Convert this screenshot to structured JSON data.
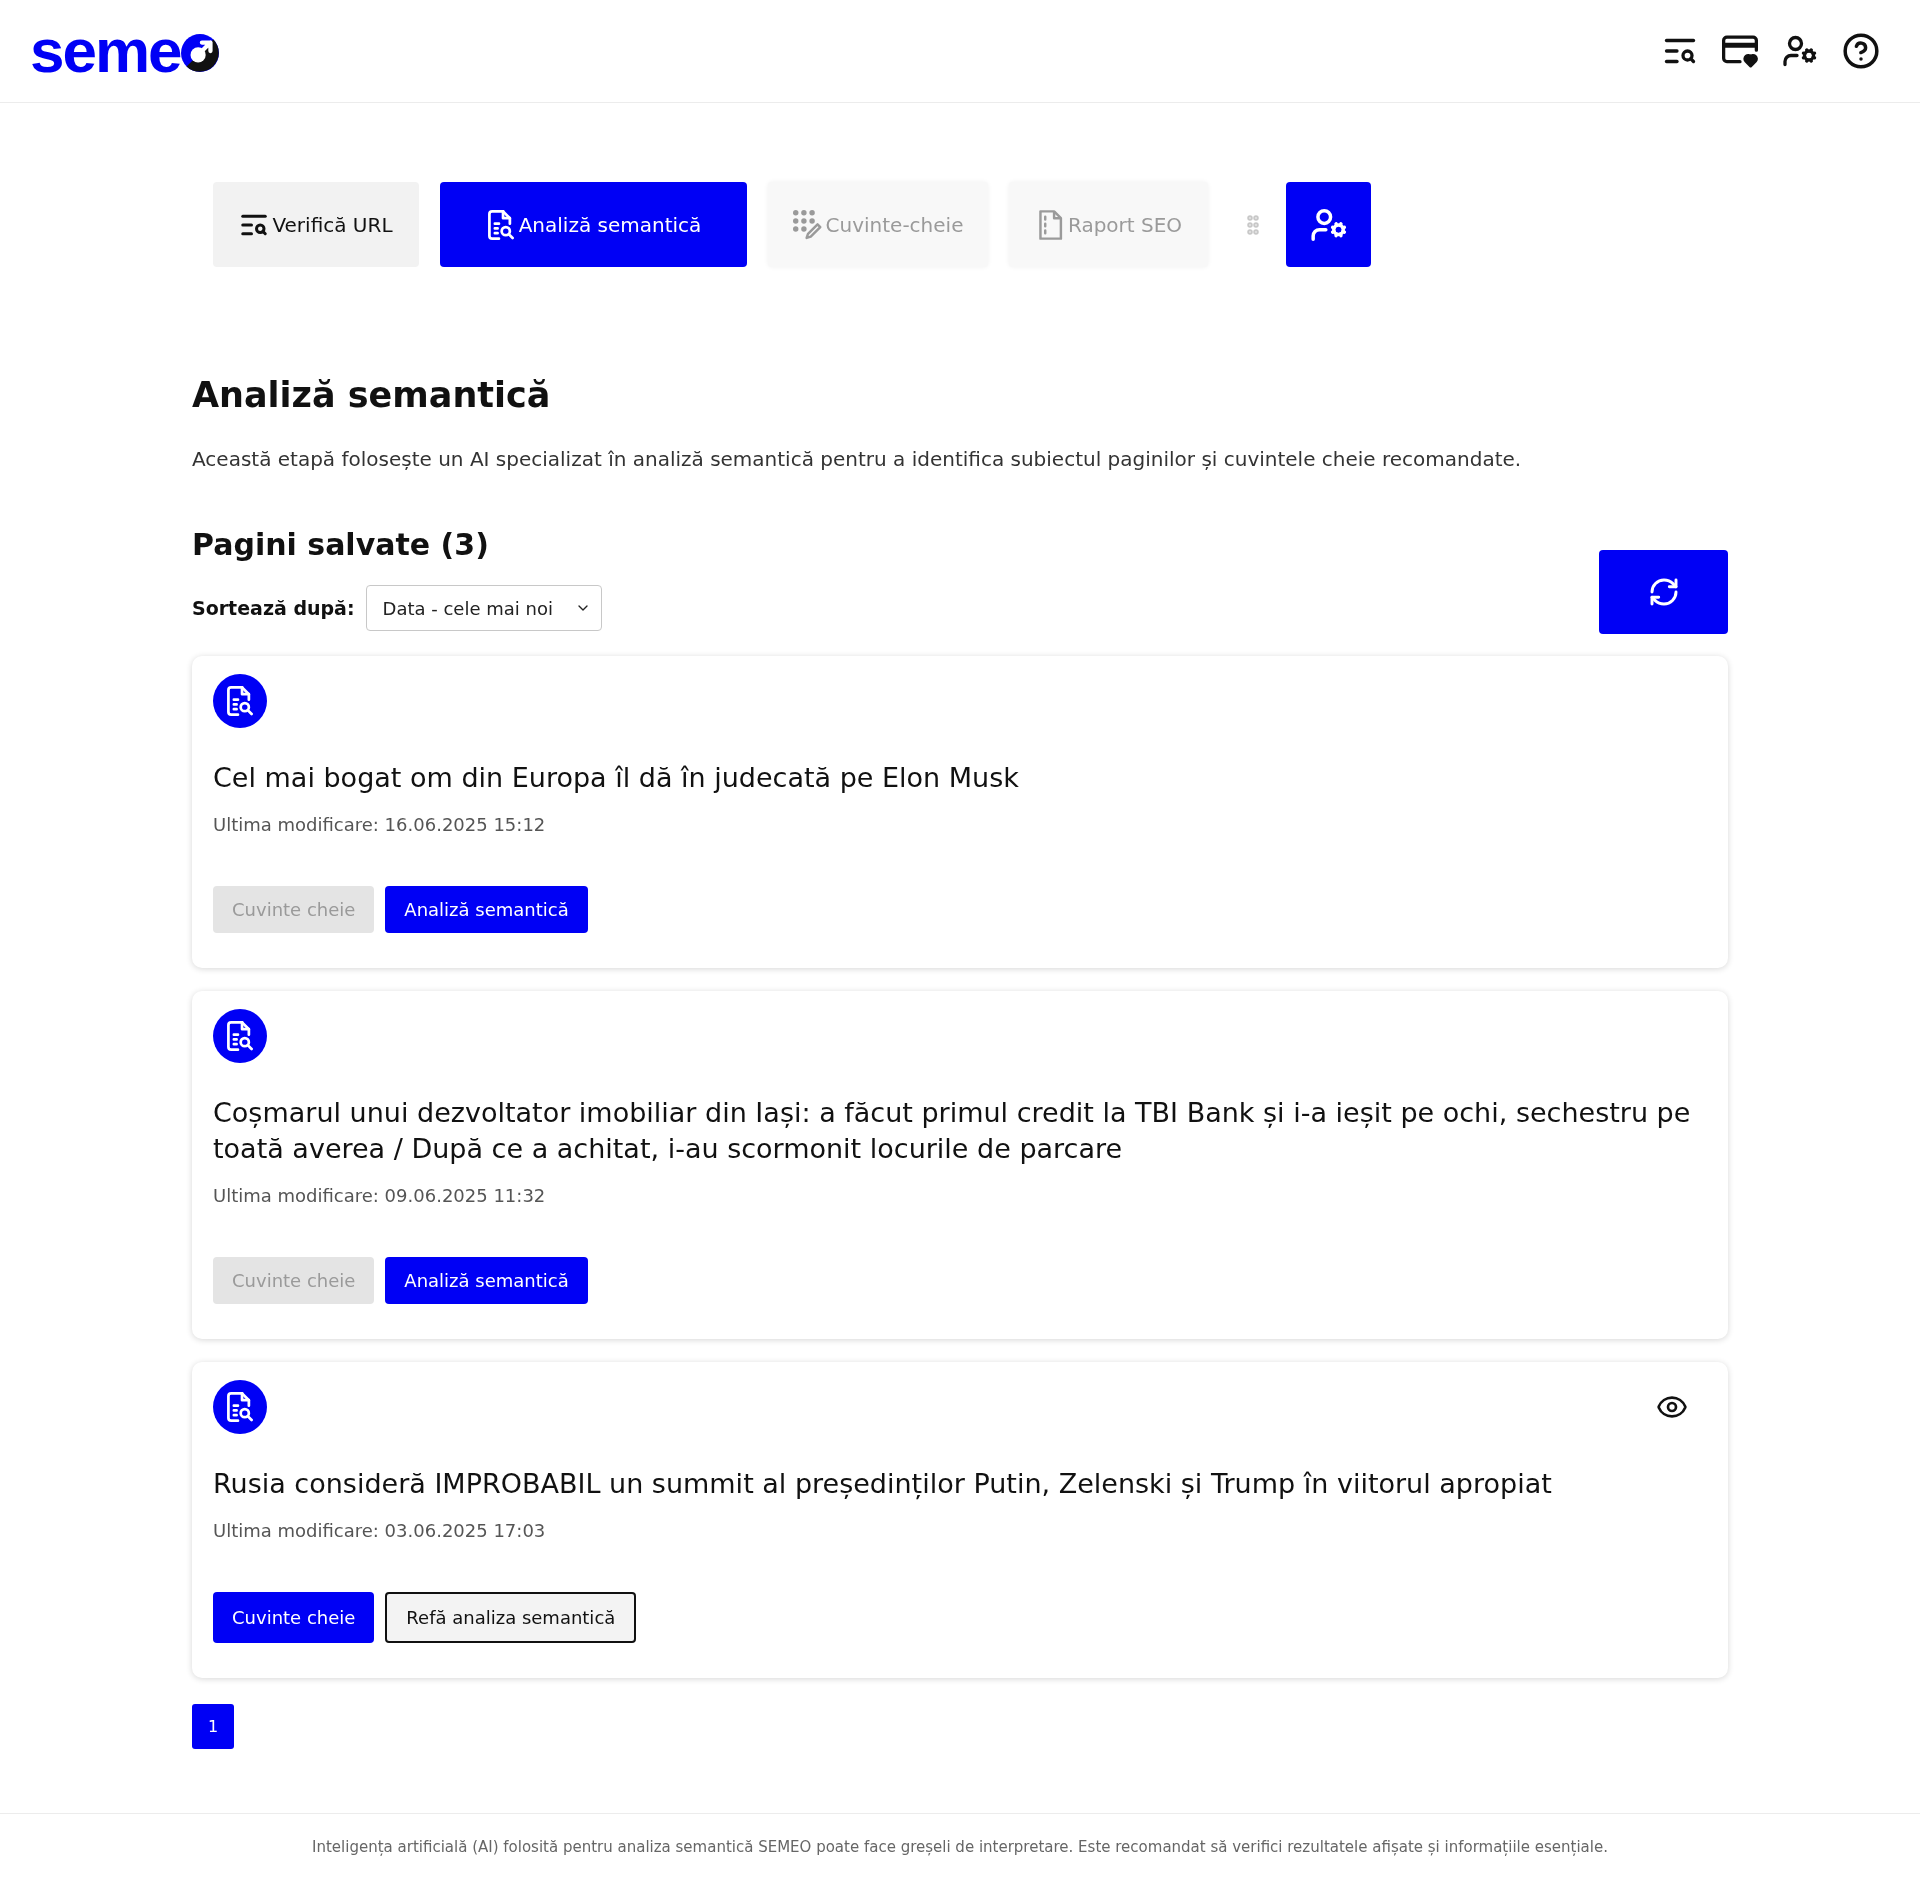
{
  "header": {
    "logo": "seme"
  },
  "tabs": [
    {
      "label": "Verifică URL",
      "kind": "url",
      "selected": false,
      "disabled": false
    },
    {
      "label": "Analiză semantică",
      "kind": "semantic",
      "selected": true,
      "disabled": false
    },
    {
      "label": "Cuvinte-cheie",
      "kind": "keywords",
      "selected": false,
      "disabled": true
    },
    {
      "label": "Raport SEO",
      "kind": "report",
      "selected": false,
      "disabled": true
    }
  ],
  "page": {
    "title": "Analiză semantică",
    "description": "Această etapă folosește un AI specializat în analiză semantică pentru a identifica subiectul paginilor și cuvintele cheie recomandate."
  },
  "saved": {
    "title": "Pagini salvate (3)",
    "sort_label": "Sortează după:",
    "sort_value": "Data - cele mai noi"
  },
  "cards": [
    {
      "title": "Cel mai bogat om din Europa îl dă în judecată pe Elon Musk",
      "modified": "Ultima modificare: 16.06.2025 15:12",
      "view_icon": false,
      "buttons": [
        {
          "label": "Cuvinte cheie",
          "kind": "primary",
          "disabled": true
        },
        {
          "label": "Analiză semantică",
          "kind": "primary",
          "disabled": false
        }
      ]
    },
    {
      "title": "Coșmarul unui dezvoltator imobiliar din Iași: a făcut primul credit la TBI Bank și i-a ieșit pe ochi, sechestru pe toată averea / După ce a achitat, i-au scormonit locurile de parcare",
      "modified": "Ultima modificare: 09.06.2025 11:32",
      "view_icon": false,
      "buttons": [
        {
          "label": "Cuvinte cheie",
          "kind": "primary",
          "disabled": true
        },
        {
          "label": "Analiză semantică",
          "kind": "primary",
          "disabled": false
        }
      ]
    },
    {
      "title": "Rusia consideră IMPROBABIL un summit al președinților Putin, Zelenski și Trump în viitorul apropiat",
      "modified": "Ultima modificare: 03.06.2025 17:03",
      "view_icon": true,
      "buttons": [
        {
          "label": "Cuvinte cheie",
          "kind": "primary",
          "disabled": false
        },
        {
          "label": "Refă analiza semantică",
          "kind": "outline",
          "disabled": false
        }
      ]
    }
  ],
  "pagination": [
    {
      "label": "1",
      "selected": true
    }
  ],
  "footer": {
    "notice": "Inteligența artificială (AI) folosită pentru analiza semantică SEMEO poate face greșeli de interpretare. Este recomandat să verifici rezultatele afișate și informațiile esențiale."
  }
}
